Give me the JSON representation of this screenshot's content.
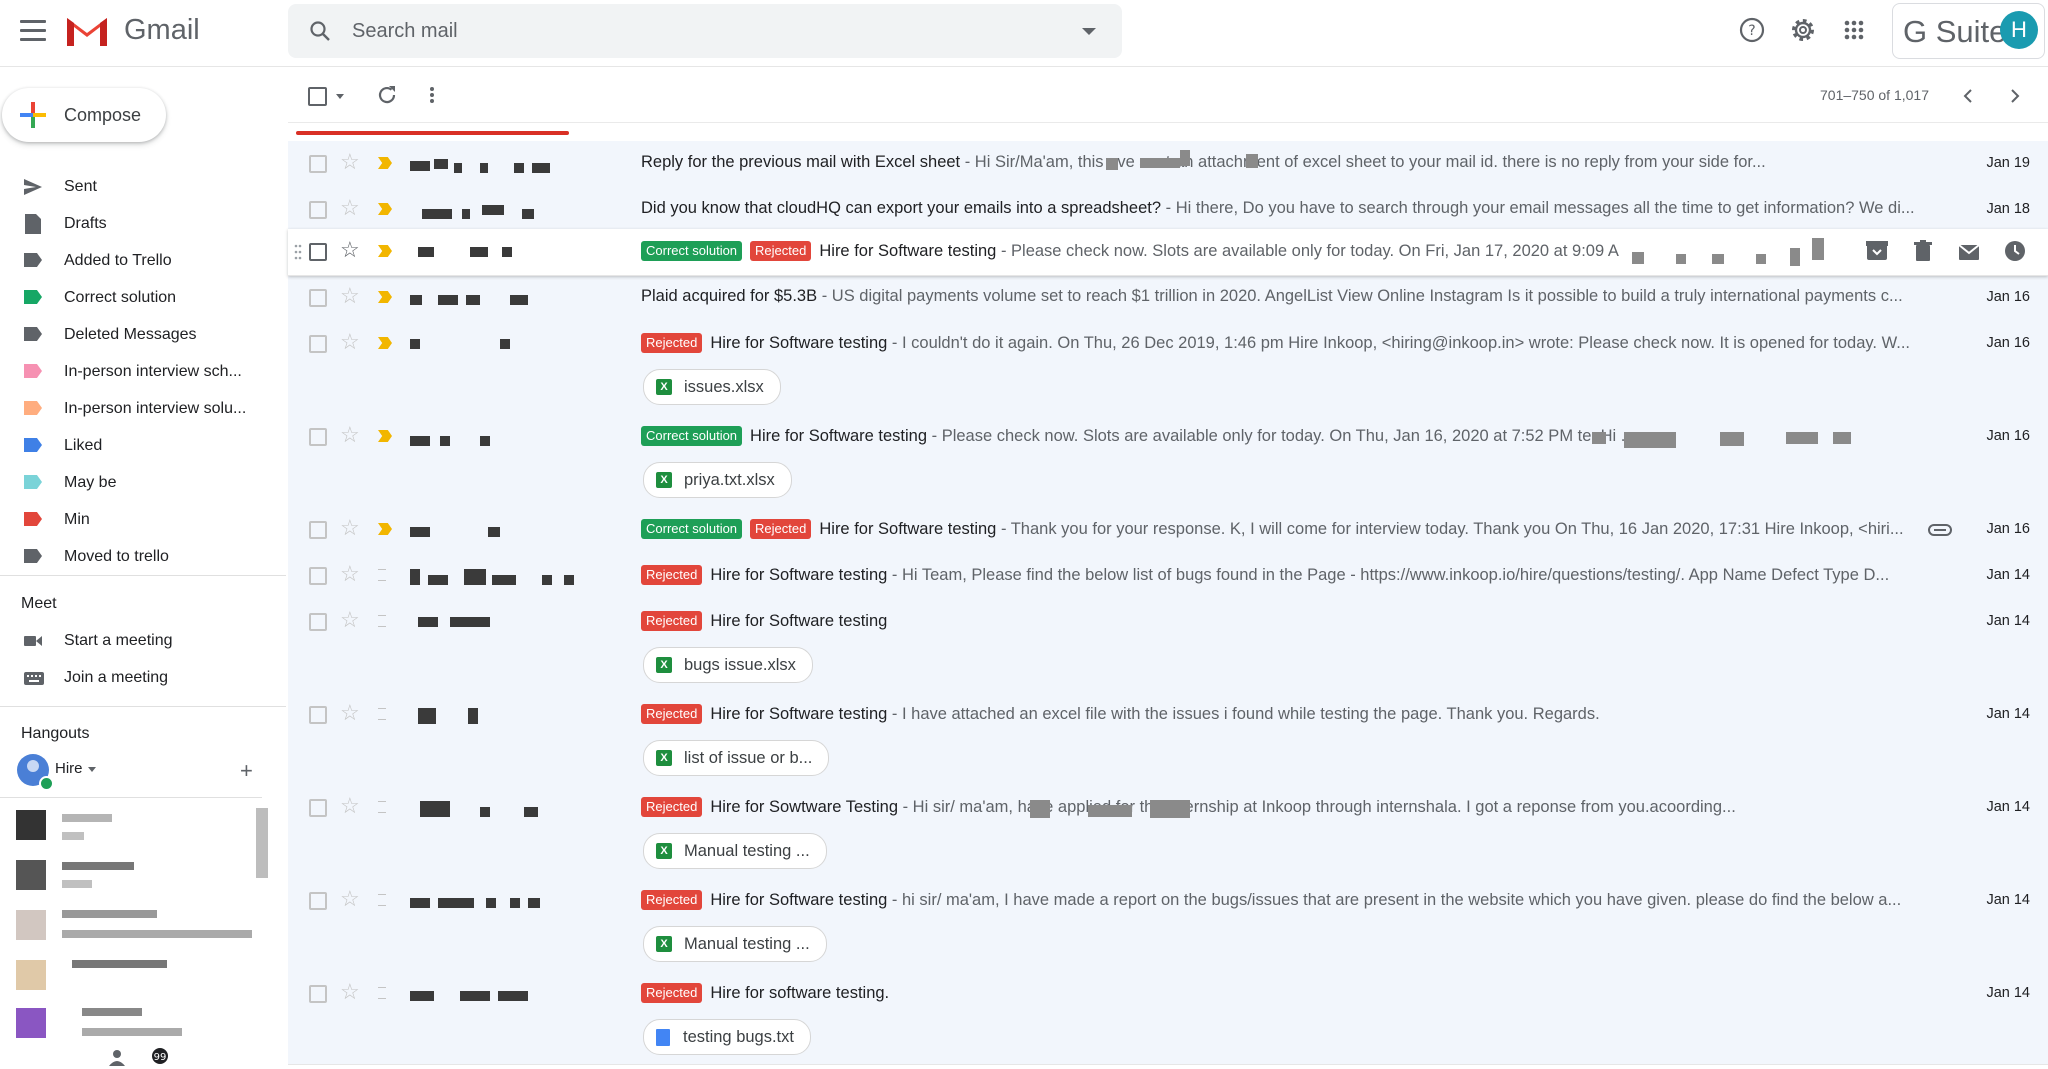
{
  "app": {
    "name": "Gmail",
    "brand": "G Suite",
    "avatar_letter": "H"
  },
  "search": {
    "placeholder": "Search mail"
  },
  "compose": {
    "label": "Compose"
  },
  "nav": [
    {
      "label": "Sent",
      "icon": "send-icon"
    },
    {
      "label": "Drafts",
      "icon": "draft-icon"
    },
    {
      "label": "Added to Trello",
      "icon": "label-icon",
      "color": "#5f6368"
    },
    {
      "label": "Correct solution",
      "icon": "label-icon",
      "color": "#16a765"
    },
    {
      "label": "Deleted Messages",
      "icon": "label-icon",
      "color": "#5f6368"
    },
    {
      "label": "In-person interview sch...",
      "icon": "label-icon",
      "color": "#f691b2"
    },
    {
      "label": "In-person interview solu...",
      "icon": "label-icon",
      "color": "#ffad7f"
    },
    {
      "label": "Liked",
      "icon": "label-icon",
      "color": "#3f80e6"
    },
    {
      "label": "May be",
      "icon": "label-icon",
      "color": "#7ad3d8"
    },
    {
      "label": "Min",
      "icon": "label-icon",
      "color": "#e2463b"
    },
    {
      "label": "Moved to trello",
      "icon": "label-icon",
      "color": "#5f6368"
    }
  ],
  "meet": {
    "title": "Meet",
    "items": [
      "Start a meeting",
      "Join a meeting"
    ]
  },
  "hangouts": {
    "title": "Hangouts",
    "user": "Hire"
  },
  "toolbar": {
    "pager": "701–750 of 1,017"
  },
  "colors": {
    "correct": "#1e9f57",
    "rejected": "#e2463b",
    "important": "#f2b600",
    "unread_bg": "#ffffff",
    "read_bg": "#f2f6fc"
  },
  "emails": [
    {
      "important": true,
      "subject": "Reply for the previous mail with Excel sheet",
      "snippet": " - Hi Sir/Ma'am, this                         ave sent an attachment of excel sheet to your mail id. there is no reply from your side for...",
      "date": "Jan 19",
      "labels": [],
      "attachment": null
    },
    {
      "important": true,
      "subject": "Did you know that cloudHQ can export your emails into a spreadsheet?",
      "snippet": " - Hi there, Do you have to search through your email messages all the time to get information? We di...",
      "date": "Jan 18",
      "labels": [],
      "attachment": null
    },
    {
      "important": true,
      "subject": "Hire for Software testing",
      "snippet": " - Please check now. Slots are available only for today. On Fri, Jan 17, 2020 at 9:09 A",
      "date": "",
      "labels": [
        "Correct solution",
        "Rejected"
      ],
      "attachment": null,
      "hover": true
    },
    {
      "important": true,
      "subject": "Plaid acquired for $5.3B",
      "snippet": " - US digital payments volume set to reach $1 trillion in 2020. AngelList View Online Instagram Is it possible to build a truly international payments c...",
      "date": "Jan 16",
      "labels": [],
      "attachment": null
    },
    {
      "important": true,
      "subject": "Hire for Software testing",
      "snippet": " - I couldn't do it again. On Thu, 26 Dec 2019, 1:46 pm Hire Inkoop, <hiring@inkoop.in> wrote: Please check now. It is opened for today. W...",
      "date": "Jan 16",
      "labels": [
        "Rejected"
      ],
      "attachment": {
        "name": "issues.xlsx",
        "type": "xlsx"
      }
    },
    {
      "important": true,
      "subject": "Hire for Software testing",
      "snippet": " - Please check now. Slots are available only for today. On Thu, Jan 16, 2020 at 7:52 PM                                             te: Hi ...",
      "date": "Jan 16",
      "labels": [
        "Correct solution"
      ],
      "attachment": {
        "name": "priya.txt.xlsx",
        "type": "xlsx"
      }
    },
    {
      "important": true,
      "subject": "Hire for Software testing",
      "snippet": " - Thank you for your response. K, I will come for interview today. Thank you On Thu, 16 Jan 2020, 17:31 Hire Inkoop, <hiri...",
      "date": "Jan 16",
      "labels": [
        "Correct solution",
        "Rejected"
      ],
      "attachment": null,
      "clip": true
    },
    {
      "important": false,
      "subject": "Hire for Software testing",
      "snippet": " - Hi Team, Please find the below list of bugs found in the Page - https://www.inkoop.io/hire/questions/testing/. App Name Defect Type D...",
      "date": "Jan 14",
      "labels": [
        "Rejected"
      ],
      "attachment": null
    },
    {
      "important": false,
      "subject": "Hire for Software testing",
      "snippet": "",
      "date": "Jan 14",
      "labels": [
        "Rejected"
      ],
      "attachment": {
        "name": "bugs issue.xlsx",
        "type": "xlsx"
      }
    },
    {
      "important": false,
      "subject": "Hire for Software testing",
      "snippet": " - I have attached an excel file with the issues i found while testing the page. Thank you. Regards.",
      "date": "Jan 14",
      "labels": [
        "Rejected"
      ],
      "attachment": {
        "name": "list of issue or b...",
        "type": "xlsx"
      }
    },
    {
      "important": false,
      "subject": "Hire for Sowtware Testing",
      "snippet": " - Hi sir/ ma'am,                                    have applied for the internship at Inkoop through internshala. I got a reponse from you.acoording...",
      "date": "Jan 14",
      "labels": [
        "Rejected"
      ],
      "attachment": {
        "name": "Manual testing ...",
        "type": "xlsx"
      }
    },
    {
      "important": false,
      "subject": "Hire for Software testing",
      "snippet": " - hi sir/ ma'am, I have made a report on the bugs/issues that are present in the website which you have given. please do find the below a...",
      "date": "Jan 14",
      "labels": [
        "Rejected"
      ],
      "attachment": {
        "name": "Manual testing ...",
        "type": "xlsx"
      }
    },
    {
      "important": false,
      "subject": "Hire for software testing.",
      "snippet": "",
      "date": "Jan 14",
      "labels": [
        "Rejected"
      ],
      "attachment": {
        "name": "testing bugs.txt",
        "type": "txt"
      }
    }
  ]
}
